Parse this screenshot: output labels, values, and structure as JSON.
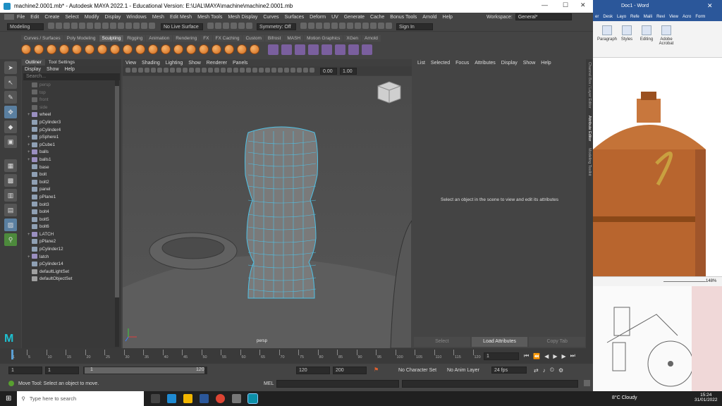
{
  "window": {
    "title": "machine2.0001.mb* - Autodesk MAYA 2022.1 - Educational Version: E:\\UAL\\MAYA\\machine\\machine2.0001.mb",
    "min": "—",
    "max": "☐",
    "close": "✕"
  },
  "menu": [
    "File",
    "Edit",
    "Create",
    "Select",
    "Modify",
    "Display",
    "Windows",
    "Mesh",
    "Edit Mesh",
    "Mesh Tools",
    "Mesh Display",
    "Curves",
    "Surfaces",
    "Deform",
    "UV",
    "Generate",
    "Cache",
    "Bonus Tools",
    "Arnold",
    "Help"
  ],
  "workspace": {
    "label": "Workspace:",
    "value": "General*"
  },
  "status_line": {
    "mode": "Modeling",
    "live_surface": "No Live Surface",
    "symmetry": "Symmetry: Off",
    "sign_in": "Sign In"
  },
  "shelf_tabs": [
    "Curves / Surfaces",
    "Poly Modeling",
    "Sculpting",
    "Rigging",
    "Animation",
    "Rendering",
    "FX",
    "FX Caching",
    "Custom",
    "Bifrost",
    "MASH",
    "Motion Graphics",
    "XGen",
    "Arnold"
  ],
  "shelf_active": "Sculpting",
  "outliner": {
    "tabs": [
      "Outliner",
      "Tool Settings"
    ],
    "menu": [
      "Display",
      "Show",
      "Help"
    ],
    "search_placeholder": "Search...",
    "items": [
      {
        "label": "persp",
        "icon": "camera-icon",
        "dim": true,
        "expand": ""
      },
      {
        "label": "top",
        "icon": "camera-icon",
        "dim": true,
        "expand": ""
      },
      {
        "label": "front",
        "icon": "camera-icon",
        "dim": true,
        "expand": ""
      },
      {
        "label": "side",
        "icon": "camera-icon",
        "dim": true,
        "expand": ""
      },
      {
        "label": "wheel",
        "icon": "group-icon",
        "dim": false,
        "expand": "+"
      },
      {
        "label": "pCylinder3",
        "icon": "mesh-icon",
        "dim": false,
        "expand": ""
      },
      {
        "label": "pCylinder4",
        "icon": "mesh-icon",
        "dim": false,
        "expand": ""
      },
      {
        "label": "pSphere1",
        "icon": "mesh-icon",
        "dim": false,
        "expand": "+"
      },
      {
        "label": "pCube1",
        "icon": "mesh-icon",
        "dim": false,
        "expand": "+"
      },
      {
        "label": "balls",
        "icon": "group-icon",
        "dim": false,
        "expand": "+"
      },
      {
        "label": "balls1",
        "icon": "group-icon",
        "dim": false,
        "expand": "+"
      },
      {
        "label": "base",
        "icon": "mesh-icon",
        "dim": false,
        "expand": ""
      },
      {
        "label": "bolt",
        "icon": "mesh-icon",
        "dim": false,
        "expand": ""
      },
      {
        "label": "bolt2",
        "icon": "mesh-icon",
        "dim": false,
        "expand": ""
      },
      {
        "label": "panel",
        "icon": "mesh-icon",
        "dim": false,
        "expand": ""
      },
      {
        "label": "pPlane1",
        "icon": "mesh-icon",
        "dim": false,
        "expand": ""
      },
      {
        "label": "bolt3",
        "icon": "mesh-icon",
        "dim": false,
        "expand": ""
      },
      {
        "label": "bolt4",
        "icon": "mesh-icon",
        "dim": false,
        "expand": ""
      },
      {
        "label": "bolt5",
        "icon": "mesh-icon",
        "dim": false,
        "expand": ""
      },
      {
        "label": "bolt6",
        "icon": "mesh-icon",
        "dim": false,
        "expand": ""
      },
      {
        "label": "LATCH",
        "icon": "group-icon",
        "dim": false,
        "expand": "+"
      },
      {
        "label": "pPlane2",
        "icon": "mesh-icon",
        "dim": false,
        "expand": ""
      },
      {
        "label": "pCylinder12",
        "icon": "mesh-icon",
        "dim": false,
        "expand": ""
      },
      {
        "label": "latch",
        "icon": "group-icon",
        "dim": false,
        "expand": "+"
      },
      {
        "label": "pCylinder14",
        "icon": "mesh-icon",
        "dim": false,
        "expand": ""
      },
      {
        "label": "defaultLightSet",
        "icon": "set-icon",
        "dim": false,
        "expand": ""
      },
      {
        "label": "defaultObjectSet",
        "icon": "set-icon",
        "dim": false,
        "expand": ""
      }
    ]
  },
  "viewport": {
    "menu": [
      "View",
      "Shading",
      "Lighting",
      "Show",
      "Renderer",
      "Panels"
    ],
    "camera_label": "persp",
    "value_a": "0.00",
    "value_b": "1.00"
  },
  "attribute_editor": {
    "menu": [
      "List",
      "Selected",
      "Focus",
      "Attributes",
      "Display",
      "Show",
      "Help"
    ],
    "message": "Select an object in the scene to view and edit its attributes",
    "buttons": [
      "Select",
      "Load Attributes",
      "Copy Tab"
    ],
    "side_tabs": [
      "Channel Box / Layer Editor",
      "Attribute Editor",
      "Modeling Toolkit"
    ]
  },
  "timeline": {
    "ticks": [
      "1",
      "5",
      "10",
      "15",
      "20",
      "25",
      "30",
      "35",
      "40",
      "45",
      "50",
      "55",
      "60",
      "65",
      "70",
      "75",
      "80",
      "85",
      "90",
      "95",
      "100",
      "105",
      "110",
      "115",
      "120"
    ],
    "current_frame": "1"
  },
  "range": {
    "start": "1",
    "start2": "1",
    "slider_start": "1",
    "slider_end": "120",
    "end": "120",
    "end2": "200",
    "character_set": "No Character Set",
    "anim_layer": "No Anim Layer",
    "fps": "24 fps"
  },
  "command": {
    "mel_label": "MEL",
    "help": "Move Tool: Select an object to move."
  },
  "word": {
    "tabs": [
      "er",
      "Desk",
      "Layo",
      "Refe",
      "Maili",
      "Revi",
      "View",
      "Acro",
      "Form"
    ],
    "title": "Doc1 - Word",
    "groups": [
      {
        "label": "Paragraph"
      },
      {
        "label": "Styles"
      },
      {
        "label": "Editing"
      },
      {
        "label": "Adobe Acrobat"
      }
    ],
    "zoom": "148%"
  },
  "taskbar": {
    "search": "Type here to search",
    "weather": "8°C  Cloudy",
    "time": "15:24",
    "date": "31/01/2022"
  },
  "colors": {
    "wire": "#4fc3e8",
    "accent": "#5a7fa0"
  }
}
